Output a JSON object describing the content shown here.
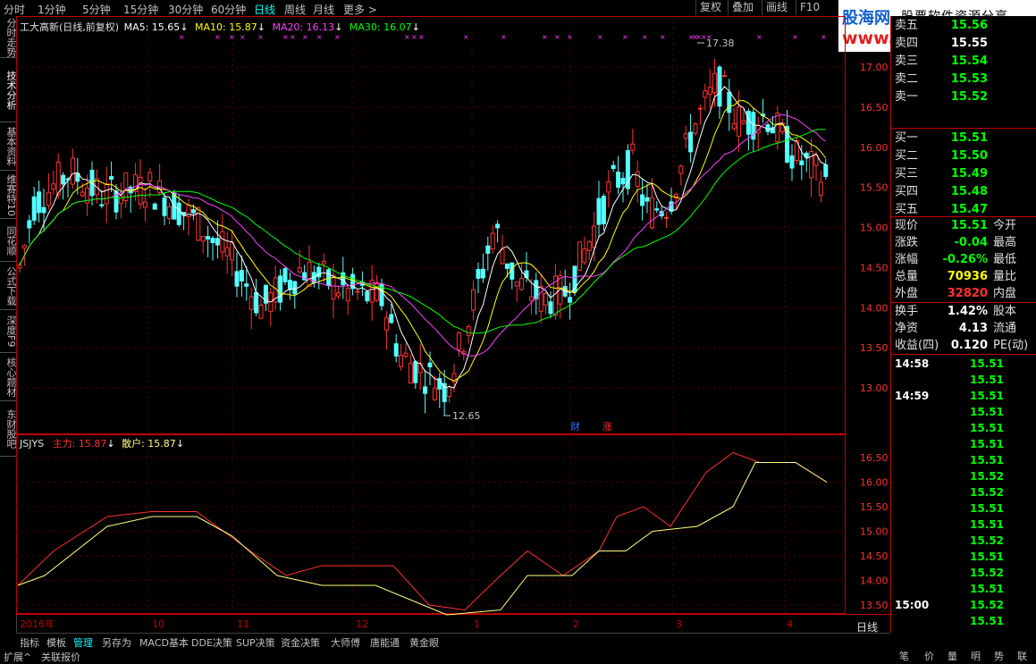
{
  "top_periods": [
    "分时",
    "1分钟",
    "5分钟",
    "15分钟",
    "30分钟",
    "60分钟",
    "日线",
    "周线",
    "月线",
    "更多 >"
  ],
  "active_period": "日线",
  "top_right_buttons": [
    "复权",
    "叠加",
    "画线",
    "F10"
  ],
  "logo": {
    "title": "股海网",
    "subtitle": "股票软件资源分享",
    "url": "www.Guhai.com.cn"
  },
  "left_tabs": [
    "分时走势",
    "技术分析",
    "基本资料",
    "维赛特10",
    "同花顺",
    "公式下载",
    "深度F9",
    "核心题材",
    "东财股吧"
  ],
  "main_chart": {
    "title": "工大高新(日线,前复权)",
    "ma5": "MA5: 15.65",
    "ma10": "MA10: 15.87",
    "ma20": "MA20: 16.13",
    "ma30": "MA30: 16.07",
    "high_label": "17.38",
    "low_label": "12.65",
    "price_ticks": [
      "17.00",
      "16.50",
      "16.00",
      "15.50",
      "15.00",
      "14.50",
      "14.00",
      "13.50",
      "13.00"
    ],
    "markers": [
      "财",
      "涨"
    ],
    "colors": {
      "up": "#ff3232",
      "down": "#54ffff",
      "ma5": "#ffffff",
      "ma10": "#ffff00",
      "ma20": "#ff40ff",
      "ma30": "#00ff00"
    }
  },
  "indicator": {
    "name": "JSJYS",
    "main_label": "主力: 15.87",
    "retail_label": "散户: 15.87",
    "ticks": [
      "16.50",
      "16.00",
      "15.50",
      "15.00",
      "14.50",
      "14.00",
      "13.50"
    ]
  },
  "x_axis": [
    "2016年",
    "10",
    "11",
    "12",
    "1",
    "2",
    "3",
    "4"
  ],
  "period_label": "日线",
  "scroll_buttons": [
    "◀",
    "-",
    "0"
  ],
  "order_book": [
    {
      "label": "卖五",
      "price": "15.56"
    },
    {
      "label": "卖四",
      "price": "15.55"
    },
    {
      "label": "卖三",
      "price": "15.54"
    },
    {
      "label": "卖二",
      "price": "15.53"
    },
    {
      "label": "卖一",
      "price": "15.52"
    },
    {
      "label": "买一",
      "price": "15.51"
    },
    {
      "label": "买二",
      "price": "15.50"
    },
    {
      "label": "买三",
      "price": "15.49"
    },
    {
      "label": "买四",
      "price": "15.48"
    },
    {
      "label": "买五",
      "price": "15.47"
    }
  ],
  "quote": [
    {
      "label": "现价",
      "value": "15.51",
      "extra": "今开"
    },
    {
      "label": "涨跌",
      "value": "-0.04",
      "extra": "最高"
    },
    {
      "label": "涨幅",
      "value": "-0.26%",
      "extra": "最低"
    },
    {
      "label": "总量",
      "value": "70936",
      "extra": "量比"
    },
    {
      "label": "外盘",
      "value": "32820",
      "extra": "内盘"
    },
    {
      "label": "换手",
      "value": "1.42%",
      "extra": "股本"
    },
    {
      "label": "净资",
      "value": "4.13",
      "extra": "流通"
    },
    {
      "label": "收益(四)",
      "value": "0.120",
      "extra": "PE(动)"
    }
  ],
  "ticks_list": [
    {
      "time": "14:58",
      "price": "15.51"
    },
    {
      "time": "",
      "price": "15.51"
    },
    {
      "time": "14:59",
      "price": "15.51"
    },
    {
      "time": "",
      "price": "15.51"
    },
    {
      "time": "",
      "price": "15.51"
    },
    {
      "time": "",
      "price": "15.51"
    },
    {
      "time": "",
      "price": "15.51"
    },
    {
      "time": "",
      "price": "15.52"
    },
    {
      "time": "",
      "price": "15.52"
    },
    {
      "time": "",
      "price": "15.51"
    },
    {
      "time": "",
      "price": "15.51"
    },
    {
      "time": "",
      "price": "15.52"
    },
    {
      "time": "",
      "price": "15.51"
    },
    {
      "time": "",
      "price": "15.52"
    },
    {
      "time": "",
      "price": "15.51"
    },
    {
      "time": "15:00",
      "price": "15.52"
    },
    {
      "time": "",
      "price": "15.51"
    }
  ],
  "bottom_tabs": [
    "指标",
    "模板",
    "管理",
    "另存为",
    "MACD基本",
    "DDE决策",
    "SUP决策",
    "资金决策",
    "大师傅",
    "唐能通",
    "黄金眼"
  ],
  "active_bottom_tab": "管理",
  "extra_tabs": [
    "扩展^",
    "关联报价"
  ],
  "side_tabs_bottom": [
    "笔",
    "价",
    "量",
    "明",
    "势",
    "联"
  ]
}
